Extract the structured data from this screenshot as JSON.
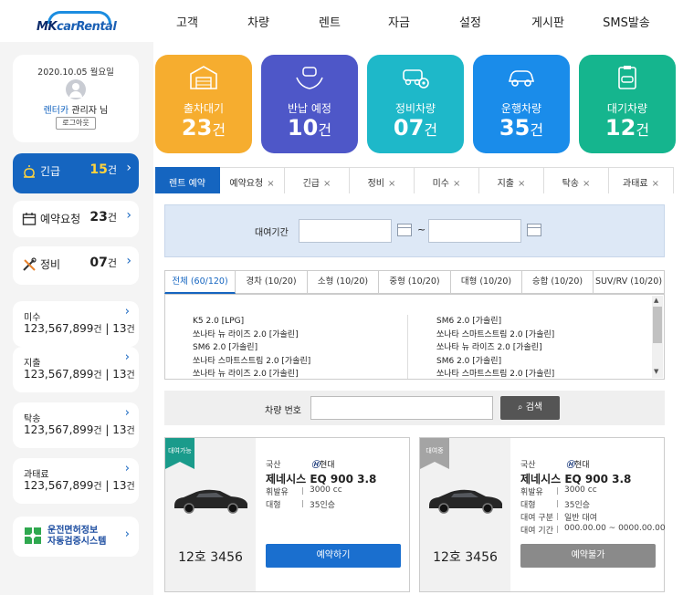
{
  "app": {
    "logo_prefix": "MK",
    "logo_suffix": "carRental"
  },
  "nav": {
    "items": [
      "고객",
      "차량",
      "렌트",
      "자금",
      "설정",
      "게시판",
      "SMS발송"
    ]
  },
  "user": {
    "date": "2020.10.05 월요일",
    "name_prefix": "렌터카",
    "name_main": " 관리자 님",
    "logout": "로그아웃"
  },
  "left_cards": [
    {
      "label": "긴급",
      "count": "15",
      "unit": "건",
      "icon": "alarm-icon"
    },
    {
      "label": "예약요청",
      "count": "23",
      "unit": "건",
      "icon": "calendar-icon"
    },
    {
      "label": "정비",
      "count": "07",
      "unit": "건",
      "icon": "tools-icon"
    }
  ],
  "money_cards": [
    {
      "label": "미수",
      "amount": "123,567,899",
      "unit": "건",
      "count": "13",
      "count_unit": "건"
    },
    {
      "label": "지출",
      "amount": "123,567,899",
      "unit": "건",
      "count": "13",
      "count_unit": "건"
    },
    {
      "label": "탁송",
      "amount": "123,567,899",
      "unit": "건",
      "count": "13",
      "count_unit": "건"
    },
    {
      "label": "과태료",
      "amount": "123,567,899",
      "unit": "건",
      "count": "13",
      "count_unit": "건"
    }
  ],
  "license": {
    "line1": "운전면허정보",
    "line2": "자동검증시스템"
  },
  "stats": [
    {
      "label": "출차대기",
      "count": "23",
      "unit": "건",
      "color": "#f6ad2f",
      "icon": "garage-icon"
    },
    {
      "label": "반납 예정",
      "count": "10",
      "unit": "건",
      "color": "#4e57c8",
      "icon": "hand-car-icon"
    },
    {
      "label": "정비차량",
      "count": "07",
      "unit": "건",
      "color": "#1eb8c9",
      "icon": "car-gear-icon"
    },
    {
      "label": "운행차량",
      "count": "35",
      "unit": "건",
      "color": "#1a8cea",
      "icon": "car-icon"
    },
    {
      "label": "대기차량",
      "count": "12",
      "unit": "건",
      "color": "#15b58e",
      "icon": "clipboard-car-icon"
    }
  ],
  "tabs": [
    {
      "label": "렌트 예약",
      "close": ""
    },
    {
      "label": "예약요청",
      "close": "×"
    },
    {
      "label": "긴급",
      "close": "×"
    },
    {
      "label": "정비",
      "close": "×"
    },
    {
      "label": "미수",
      "close": "×"
    },
    {
      "label": "지출",
      "close": "×"
    },
    {
      "label": "탁송",
      "close": "×"
    },
    {
      "label": "과태료",
      "close": "×"
    }
  ],
  "filter": {
    "label": "대여기간",
    "tilde": "~"
  },
  "subtabs": [
    "전체 (60/120)",
    "경차 (10/20)",
    "소형 (10/20)",
    "중형 (10/20)",
    "대형 (10/20)",
    "승합 (10/20)",
    "SUV/RV (10/20)"
  ],
  "models_left": [
    "K5 2.0 [LPG]",
    "쏘나타 뉴 라이즈 2.0 [가솔린]",
    "SM6 2.0 [가솔린]",
    "쏘나타 스마트스트림 2.0 [가솔린]",
    "쏘나타 뉴 라이즈 2.0 [가솔린]"
  ],
  "models_right": [
    "SM6 2.0 [가솔린]",
    "쏘나타 스마트스트림 2.0 [가솔린]",
    "쏘나타 뉴 라이즈 2.0 [가솔린]",
    "SM6 2.0 [가솔린]",
    "쏘나타 스마트스트림 2.0 [가솔린]"
  ],
  "search": {
    "label": "차량 번호",
    "button": "검색"
  },
  "vehicles": [
    {
      "badge": "대여가능",
      "badge_color": "#1a9b8b",
      "origin": "국산",
      "brand": "현대",
      "model": "제네시스 EQ 900 3.8",
      "specs": [
        {
          "k": "휘발유",
          "v": "3000 cc"
        },
        {
          "k": "대형",
          "v": "35인승"
        }
      ],
      "plate": "12호 3456",
      "button": "예약하기",
      "button_color": "#1a6fcf"
    },
    {
      "badge": "대여중",
      "badge_color": "#a4a4a4",
      "origin": "국산",
      "brand": "현대",
      "model": "제네시스 EQ 900 3.8",
      "specs": [
        {
          "k": "휘발유",
          "v": "3000 cc"
        },
        {
          "k": "대형",
          "v": "35인승"
        },
        {
          "k": "대여 구분",
          "v": "일반 대여"
        },
        {
          "k": "대여 기간",
          "v": "000.00.00 ~ 0000.00.00"
        }
      ],
      "plate": "12호 3456",
      "button": "예약불가",
      "button_color": "#8a8a8a"
    }
  ]
}
